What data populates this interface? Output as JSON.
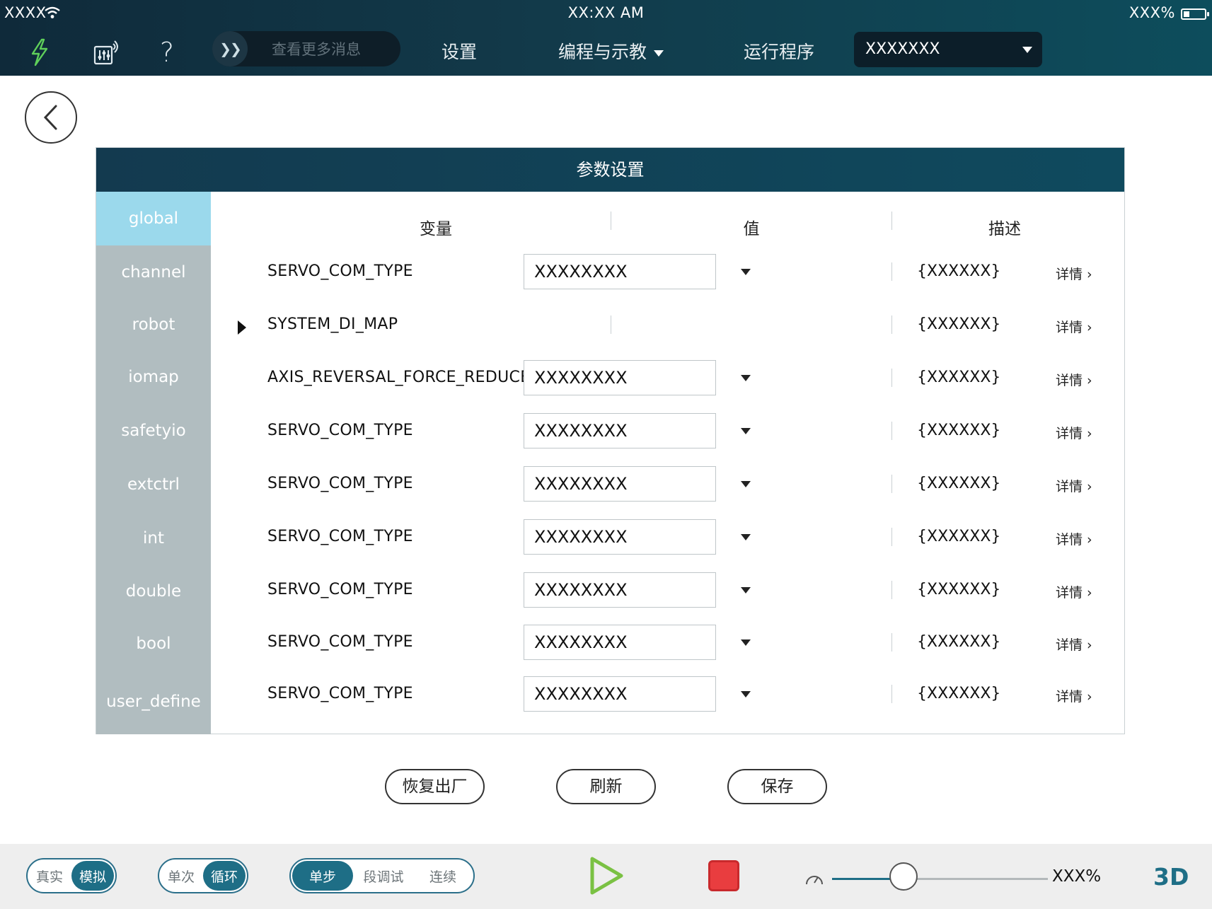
{
  "status_bar": {
    "carrier": "XXXX",
    "time": "XX:XX AM",
    "battery": "XXX%"
  },
  "top_nav": {
    "message_placeholder": "查看更多消息",
    "settings": "设置",
    "program_teach": "编程与示教",
    "run_program": "运行程序",
    "program_select": "XXXXXXX",
    "help_glyph": "?"
  },
  "panel": {
    "title": "参数设置",
    "sidebar": [
      {
        "label": "global",
        "active": true
      },
      {
        "label": "channel"
      },
      {
        "label": "robot"
      },
      {
        "label": "iomap"
      },
      {
        "label": "safetyio"
      },
      {
        "label": "extctrl"
      },
      {
        "label": "int"
      },
      {
        "label": "double"
      },
      {
        "label": "bool"
      },
      {
        "label": "user_define"
      }
    ],
    "columns": [
      "变量",
      "值",
      "描述"
    ],
    "detail_label": "详情",
    "rows": [
      {
        "name": "SERVO_COM_TYPE",
        "value": "XXXXXXXX",
        "desc": "{XXXXXX}"
      },
      {
        "name": "SYSTEM_DI_MAP",
        "value": "",
        "desc": "{XXXXXX}",
        "expandable": true
      },
      {
        "name": "AXIS_REVERSAL_FORCE_REDUCE_SCALE",
        "value": "XXXXXXXX",
        "desc": "{XXXXXX}"
      },
      {
        "name": "SERVO_COM_TYPE",
        "value": "XXXXXXXX",
        "desc": "{XXXXXX}"
      },
      {
        "name": "SERVO_COM_TYPE",
        "value": "XXXXXXXX",
        "desc": "{XXXXXX}"
      },
      {
        "name": "SERVO_COM_TYPE",
        "value": "XXXXXXXX",
        "desc": "{XXXXXX}"
      },
      {
        "name": "SERVO_COM_TYPE",
        "value": "XXXXXXXX",
        "desc": "{XXXXXX}"
      },
      {
        "name": "SERVO_COM_TYPE",
        "value": "XXXXXXXX",
        "desc": "{XXXXXX}"
      },
      {
        "name": "SERVO_COM_TYPE",
        "value": "XXXXXXXX",
        "desc": "{XXXXXX}"
      }
    ]
  },
  "actions": {
    "restore": "恢复出厂",
    "refresh": "刷新",
    "save": "保存"
  },
  "bottom_bar": {
    "mode": {
      "real": "真实",
      "sim": "模拟",
      "selected": "模拟"
    },
    "repeat": {
      "once": "单次",
      "loop": "循环",
      "selected": "循环"
    },
    "step": {
      "single": "单步",
      "segment": "段调试",
      "continuous": "连续",
      "selected": "单步"
    },
    "speed_value": "XXX%",
    "speed_fraction": 0.33,
    "view_3d": "3D"
  },
  "colors": {
    "accent": "#1e6e86",
    "active_sidebar": "#9bd9ec",
    "sidebar": "#b1bdc0",
    "play": "#7ac143",
    "stop": "#e93d3f"
  }
}
